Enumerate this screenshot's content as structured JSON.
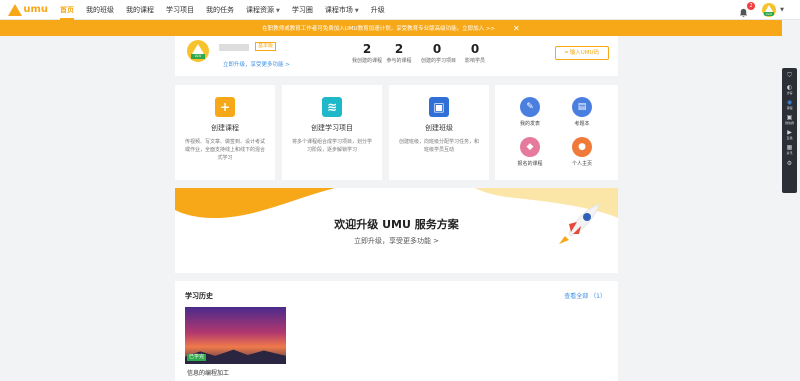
{
  "brand": {
    "name": "umu",
    "accent": "#f7a818"
  },
  "nav": {
    "items": [
      {
        "label": "首页",
        "active": true,
        "dropdown": false
      },
      {
        "label": "我的班级",
        "dropdown": false
      },
      {
        "label": "我的课程",
        "dropdown": false
      },
      {
        "label": "学习项目",
        "dropdown": false
      },
      {
        "label": "我的任务",
        "dropdown": false
      },
      {
        "label": "课程资源",
        "dropdown": true
      },
      {
        "label": "学习圈",
        "dropdown": false
      },
      {
        "label": "课程市场",
        "dropdown": true
      },
      {
        "label": "升级",
        "dropdown": false
      }
    ],
    "notification_count": "2",
    "avatar_tag": "LV.0"
  },
  "notice": {
    "text": "在职教师或教育工作者可免费加入UMU教育加速计划，享受教育专业版高级功能。立即加入 >>"
  },
  "profile": {
    "badge": "基本版",
    "upgrade_link": "立即升级，享受更多功能 >",
    "avatar_tag": "LV.0",
    "stats": [
      {
        "value": "2",
        "label": "我创建的课程"
      },
      {
        "value": "2",
        "label": "参与的课程"
      },
      {
        "value": "0",
        "label": "创建的学习项目"
      },
      {
        "value": "0",
        "label": "影响学员"
      }
    ],
    "invite_button": "输入UMU码"
  },
  "actions": [
    {
      "title": "创建课程",
      "desc": "传视频、写文章、做签到、设计考试或作业，全面支持线上和线下的混合式学习",
      "icon": "plus-icon",
      "color": "#f7a818",
      "glyph": "+"
    },
    {
      "title": "创建学习项目",
      "desc": "将多个课程组合成学习项目，划分学习阶段，逐步解锁学习",
      "icon": "layers-icon",
      "color": "#1fb8c9",
      "glyph": "≋"
    },
    {
      "title": "创建班级",
      "desc": "创建班级，向班级分配学习任务，和班级学员互动",
      "icon": "class-icon",
      "color": "#2f6fd6",
      "glyph": "▣"
    }
  ],
  "shortcuts": [
    {
      "label": "我的发表",
      "icon": "publish-icon",
      "color": "#4a7fe0",
      "glyph": "✎"
    },
    {
      "label": "考题本",
      "icon": "question-book-icon",
      "color": "#4a7fe0",
      "glyph": "▤"
    },
    {
      "label": "报名的课程",
      "icon": "enrolled-icon",
      "color": "#e57a9c",
      "glyph": "◆"
    },
    {
      "label": "个人主页",
      "icon": "profile-icon",
      "color": "#f07a3a",
      "glyph": "●"
    }
  ],
  "promo": {
    "title": "欢迎升级 UMU 服务方案",
    "subtitle": "立即升级，享受更多功能 >"
  },
  "history": {
    "title": "学习历史",
    "view_all": "查看全部 （1）",
    "items": [
      {
        "tag": "已学完",
        "name": "信息的编程加工"
      }
    ]
  },
  "sidebar": {
    "items": [
      {
        "label": "",
        "icon": "shield-icon",
        "glyph": "⛉"
      },
      {
        "label": "访客",
        "icon": "visitor-icon",
        "glyph": "◐"
      },
      {
        "label": "课程",
        "icon": "course-icon",
        "glyph": "◉",
        "active": true
      },
      {
        "label": "微信群",
        "icon": "wechat-group-icon",
        "glyph": "▣"
      },
      {
        "label": "直播",
        "icon": "live-icon",
        "glyph": "▶"
      },
      {
        "label": "资讯",
        "icon": "news-icon",
        "glyph": "▦"
      },
      {
        "label": "",
        "icon": "settings-icon",
        "glyph": "⚙"
      }
    ]
  }
}
